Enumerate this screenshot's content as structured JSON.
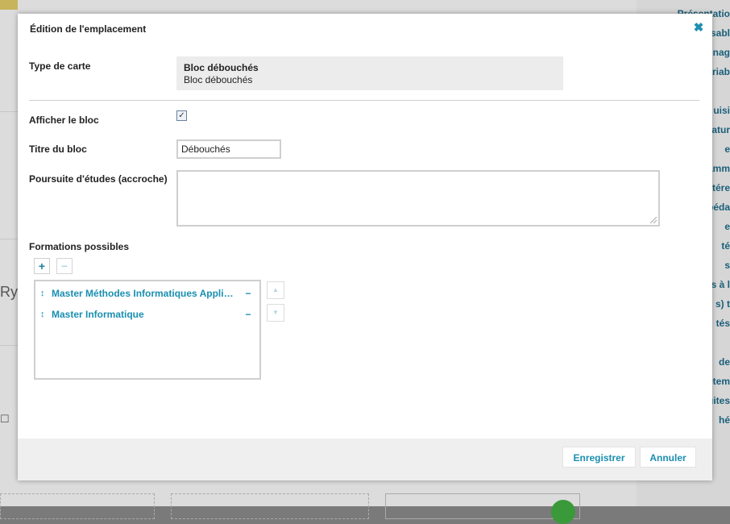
{
  "background": {
    "sidebar_items": [
      "Présentatio",
      "nsabl",
      "gnag",
      "ariab",
      "uisi",
      "natur",
      "e",
      "amm",
      "tére",
      "péda",
      "e",
      "té",
      "s",
      "s à l",
      "s) t",
      "tés",
      "de",
      "étem",
      "uites",
      "hé"
    ],
    "left_text": "Ryt",
    "left_icon": "☐"
  },
  "dialog": {
    "title": "Édition de l'emplacement",
    "close_icon": "✖"
  },
  "fields": {
    "type_label": "Type de carte",
    "type_value_bold": "Bloc débouchés",
    "type_value": "Bloc débouchés",
    "show_label": "Afficher le bloc",
    "show_checked": true,
    "show_checkmark": "✓",
    "title_label": "Titre du bloc",
    "title_value": "Débouchés",
    "pursuit_label": "Poursuite d'études (accroche)",
    "pursuit_value": "",
    "formations_label": "Formations possibles"
  },
  "formations": {
    "add_symbol": "+",
    "remove_symbol": "−",
    "drag_symbol": "↕",
    "item_remove_symbol": "−",
    "up_symbol": "▲",
    "down_symbol": "▼",
    "items": [
      {
        "name": "Master Méthodes Informatiques Appliquées"
      },
      {
        "name": "Master Informatique"
      }
    ]
  },
  "footer": {
    "save_label": "Enregistrer",
    "cancel_label": "Annuler"
  },
  "colors": {
    "accent": "#1a8fb0",
    "overlay": "#7a7a7a",
    "footer_bg": "#efefef"
  }
}
